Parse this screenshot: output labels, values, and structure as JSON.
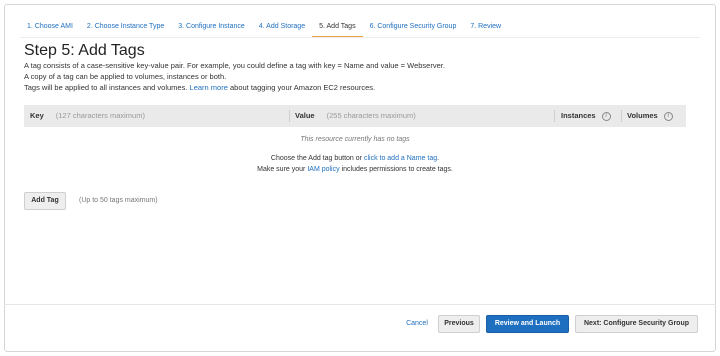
{
  "wizard": {
    "steps": [
      {
        "label": "1. Choose AMI"
      },
      {
        "label": "2. Choose Instance Type"
      },
      {
        "label": "3. Configure Instance"
      },
      {
        "label": "4. Add Storage"
      },
      {
        "label": "5. Add Tags"
      },
      {
        "label": "6. Configure Security Group"
      },
      {
        "label": "7. Review"
      }
    ],
    "active_index": 4
  },
  "page": {
    "title": "Step 5: Add Tags",
    "desc_line1": "A tag consists of a case-sensitive key-value pair. For example, you could define a tag with key = Name and value = Webserver.",
    "desc_line2": "A copy of a tag can be applied to volumes, instances or both.",
    "desc_line3_prefix": "Tags will be applied to all instances and volumes.",
    "learn_more": "Learn more",
    "desc_line3_suffix": "about tagging your Amazon EC2 resources."
  },
  "table": {
    "key_header": "Key",
    "key_hint": "(127 characters maximum)",
    "value_header": "Value",
    "value_hint": "(255 characters maximum)",
    "instances_header": "Instances",
    "volumes_header": "Volumes",
    "info_glyph": "i",
    "empty_text": "This resource currently has no tags",
    "choose_prefix": "Choose the Add tag button or",
    "choose_link": "click to add a Name tag",
    "choose_suffix": ".",
    "iam_prefix": "Make sure your",
    "iam_link": "IAM policy",
    "iam_suffix": "includes permissions to create tags."
  },
  "add_tag": {
    "label": "Add Tag",
    "hint": "(Up to 50 tags maximum)"
  },
  "footer": {
    "cancel": "Cancel",
    "previous": "Previous",
    "review_launch": "Review and Launch",
    "next": "Next: Configure Security Group"
  },
  "colors": {
    "link": "#1f6fbf",
    "primary_button": "#1e6fc0",
    "active_step_underline": "#f0a24a",
    "table_header_bg": "#eaeaea"
  }
}
